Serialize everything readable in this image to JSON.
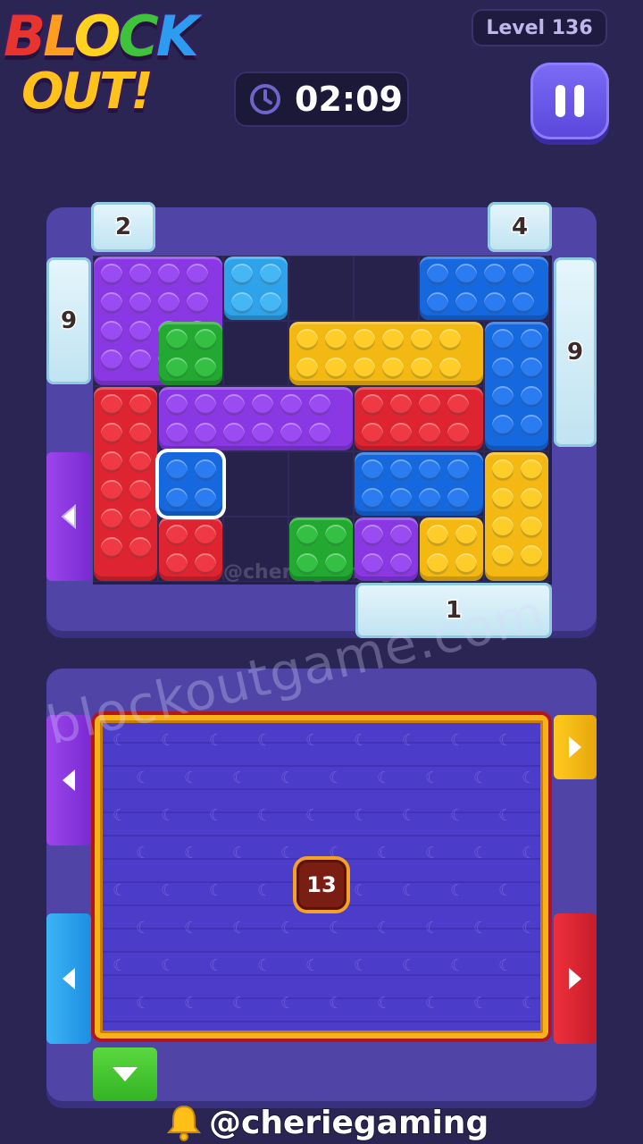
{
  "header": {
    "logo_line1": "BLOCK",
    "logo_line2": "OUT!",
    "level_label": "Level 136",
    "timer": "02:09",
    "pause_icon": "pause-icon",
    "clock_icon": "clock-icon"
  },
  "board": {
    "ice_top_left": "2",
    "ice_top_right": "4",
    "ice_left": "9",
    "ice_right": "9",
    "ice_bottom": "1",
    "watermark": "@cheriegaming"
  },
  "tray": {
    "count": "13",
    "watermark": "blockoutgame.com"
  },
  "footer": {
    "handle": "@cheriegaming",
    "bell_icon": "bell-icon"
  },
  "colors": {
    "purple": "#8a37e4",
    "blue": "#1668de",
    "light_blue": "#2ea3ea",
    "green": "#23a832",
    "yellow": "#f3b811",
    "red": "#de2430"
  }
}
